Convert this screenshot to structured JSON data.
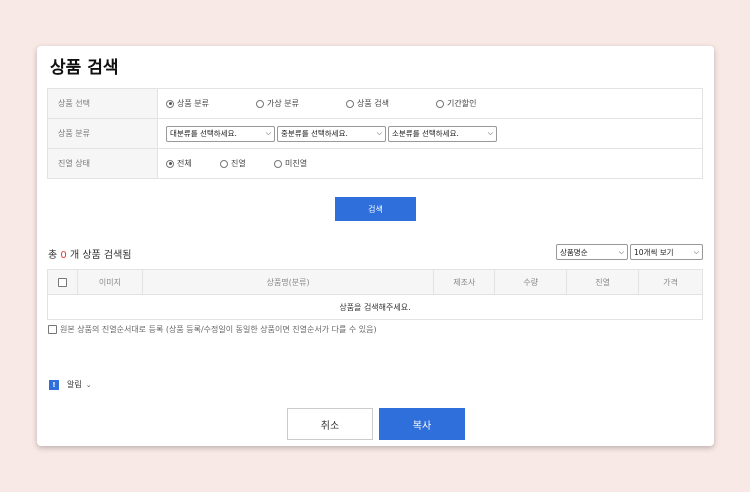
{
  "dialog": {
    "title": "상품 검색"
  },
  "search": {
    "select_row": {
      "label": "상품 선택",
      "options": [
        "상품 분류",
        "가상 분류",
        "상품 검색",
        "기간할인"
      ],
      "selected_index": 0
    },
    "category_row": {
      "label": "상품 분류",
      "selects": [
        "대분류를 선택하세요.",
        "중분류를 선택하세요.",
        "소분류를 선택하세요."
      ]
    },
    "display_row": {
      "label": "진열 상태",
      "options": [
        "전체",
        "진열",
        "미진열"
      ],
      "selected_index": 0
    },
    "button_label": "검색"
  },
  "results": {
    "count_prefix": "총",
    "count": "0",
    "count_suffix": "개 상품 검색됨",
    "sort_value": "상품명순",
    "page_size_value": "10개씩 보기",
    "columns": [
      "이미지",
      "상품명(분류)",
      "제조사",
      "수량",
      "진열",
      "가격"
    ],
    "empty_message": "상품을 검색해주세요."
  },
  "copy_order_label": "원본 상품의 진열순서대로 등록 (상품 등록/수정일이 동일한 상품이면 진열순서가 다를 수 있음)",
  "notice": {
    "badge": "!",
    "label": "알림"
  },
  "footer": {
    "cancel_label": "취소",
    "copy_label": "복사"
  },
  "colors": {
    "accent": "#2e6fdb",
    "count": "#e03a2f",
    "background": "#f9e9e6"
  }
}
